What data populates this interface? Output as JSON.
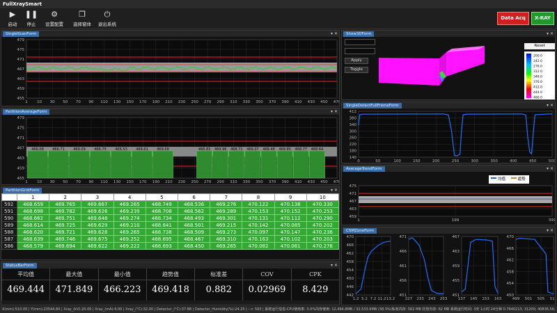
{
  "app": {
    "title": "FullXraySmart"
  },
  "toolbar": {
    "buttons": [
      {
        "label": "启动",
        "icon": "play-icon"
      },
      {
        "label": "停止",
        "icon": "pause-icon"
      },
      {
        "label": "设置配置",
        "icon": "gear-icon"
      },
      {
        "label": "选择窗体",
        "icon": "window-select-icon"
      },
      {
        "label": "退出系统",
        "icon": "power-icon"
      }
    ],
    "data_acq_label": "Data Acq",
    "xray_label": "X-RAY"
  },
  "panels": {
    "single_scan": "SingleScanForm",
    "partition_average": "PartitionAverageForm",
    "partition_grid": "PartitionGridForm",
    "status_bar": "StatusBarForm",
    "show3d": "Show3DForm",
    "single_detect": "SingleDetectFullFrameForm",
    "average_trend": "AverageTrendForm",
    "cursor_zone": "CSMZoneForm"
  },
  "single_scan_chart": {
    "y_ticks": [
      "479",
      "475",
      "471",
      "467",
      "463",
      "459",
      "455"
    ],
    "x_ticks": [
      "1",
      "10",
      "30",
      "50",
      "70",
      "90",
      "110",
      "130",
      "150",
      "170",
      "190",
      "210",
      "230",
      "250",
      "270",
      "290",
      "310",
      "330",
      "350",
      "370",
      "390",
      "410",
      "430",
      "450",
      "470"
    ]
  },
  "partition_chart": {
    "y_ticks": [
      "479",
      "475",
      "471",
      "467",
      "463",
      "459",
      "455"
    ],
    "x_ticks": [
      "1",
      "10",
      "30",
      "50",
      "70",
      "90",
      "110",
      "130",
      "150",
      "170",
      "190",
      "210",
      "230",
      "250",
      "270",
      "290",
      "310",
      "330",
      "350",
      "370",
      "390",
      "410",
      "430",
      "450",
      "470"
    ],
    "bar_labels": [
      "466.08",
      "466.71",
      "469.09",
      "466.75",
      "466.53",
      "468.61",
      "469.58",
      "468.83",
      "469.96",
      "468.71",
      "469.07",
      "468.48",
      "469.85",
      "468.77",
      "468.64"
    ]
  },
  "grid": {
    "columns": [
      "1",
      "2",
      "3",
      "4",
      "5",
      "6",
      "7",
      "8",
      "9",
      "10"
    ],
    "rows": [
      {
        "id": "592",
        "cells": [
          "468.659",
          "469.765",
          "469.667",
          "469.265",
          "468.749",
          "468.536",
          "469.276",
          "470.122",
          "470.138",
          "470.330"
        ]
      },
      {
        "id": "591",
        "cells": [
          "468.698",
          "469.782",
          "469.626",
          "469.239",
          "468.708",
          "468.562",
          "469.289",
          "470.153",
          "470.152",
          "470.253"
        ]
      },
      {
        "id": "590",
        "cells": [
          "468.662",
          "469.751",
          "469.648",
          "469.274",
          "468.734",
          "468.493",
          "469.301",
          "470.131",
          "470.112",
          "470.290"
        ]
      },
      {
        "id": "589",
        "cells": [
          "468.614",
          "469.725",
          "469.629",
          "469.210",
          "468.641",
          "468.501",
          "469.215",
          "470.142",
          "470.085",
          "470.202"
        ]
      },
      {
        "id": "588",
        "cells": [
          "468.620",
          "469.721",
          "469.628",
          "469.265",
          "468.738",
          "468.509",
          "469.273",
          "470.097",
          "470.147",
          "470.236"
        ]
      },
      {
        "id": "587",
        "cells": [
          "468.639",
          "469.746",
          "469.675",
          "469.252",
          "468.695",
          "468.467",
          "469.310",
          "470.163",
          "470.102",
          "470.203"
        ]
      },
      {
        "id": "586",
        "cells": [
          "468.579",
          "469.694",
          "469.622",
          "469.222",
          "468.693",
          "468.450",
          "469.265",
          "470.082",
          "470.061",
          "470.276"
        ]
      }
    ]
  },
  "stats": [
    {
      "label": "平均值",
      "value": "469.444"
    },
    {
      "label": "最大值",
      "value": "471.849"
    },
    {
      "label": "最小值",
      "value": "466.223"
    },
    {
      "label": "趋势值",
      "value": "469.418"
    },
    {
      "label": "标准差",
      "value": "0.882"
    },
    {
      "label": "COV",
      "value": "0.02969"
    },
    {
      "label": "CPK",
      "value": "8.429"
    }
  ],
  "show3d": {
    "apply_label": "Apply",
    "toggle_label": "Toggle",
    "reset_label": "Reset",
    "scale": [
      "200.0",
      "242.0",
      "276.0",
      "312.0",
      "348.0",
      "376.0",
      "412.0",
      "444.0",
      "480.0"
    ]
  },
  "single_detect_chart": {
    "y_ticks": [
      "412",
      "380",
      "340",
      "300",
      "260",
      "220",
      "180",
      "140"
    ],
    "x_ticks": [
      "0",
      "50",
      "100",
      "150",
      "200",
      "250",
      "300",
      "350",
      "400",
      "450",
      "500"
    ]
  },
  "trend_chart": {
    "y_ticks": [
      "475",
      "471",
      "467",
      "463",
      "459"
    ],
    "x_ticks": [
      "1",
      "199",
      "399"
    ],
    "legend": [
      "均值",
      "趋势"
    ]
  },
  "zone_charts": [
    {
      "y_ticks": [
        "470",
        "466",
        "462",
        "458",
        "454",
        "450",
        "446",
        "442"
      ],
      "x_ticks": [
        "1.2",
        "5.2",
        "7.2",
        "11.2",
        "13.2"
      ]
    },
    {
      "y_ticks": [
        "471",
        "466",
        "461",
        "456",
        "451"
      ],
      "x_ticks": [
        "227",
        "233",
        "243",
        "253"
      ]
    },
    {
      "y_ticks": [
        "467",
        "463",
        "459",
        "455",
        "451"
      ],
      "x_ticks": [
        "137",
        "145",
        "153",
        "163"
      ]
    },
    {
      "y_ticks": [
        "470",
        "466",
        "462",
        "458",
        "454",
        "450"
      ],
      "x_ticks": [
        "499",
        "501",
        "505",
        "511"
      ]
    }
  ],
  "statusbar": {
    "text": "X(mm):510.00 | Y(mm):23544.84 | Xray_(kV):20.00 | Xray_(mA):4.00 | Xray_(°C):32.00 | Detector_(°C):37.88 | Detector_Humidity(%):24.25 | --> 593 | 系统运行信息:CPU使用率: 3.0%内存使用: 12,464.8MB / 32,533.6MB (38.3%)私有内存: 562 MB 托管内存: 62 MB 系统运行时间: 3天 1小时 24分钟 0.7640213, 31200; 40836.56; 1.7"
  }
}
